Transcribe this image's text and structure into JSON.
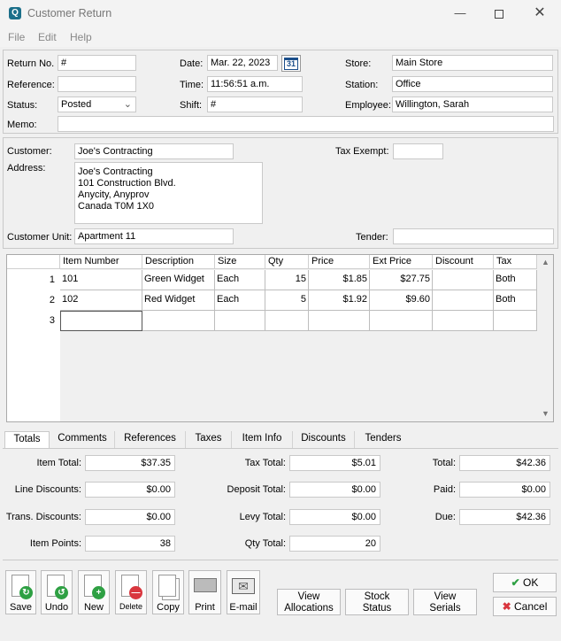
{
  "window": {
    "title": "Customer Return",
    "app_icon": "Q"
  },
  "menu": [
    "File",
    "Edit",
    "Help"
  ],
  "header": {
    "return_no_label": "Return No.",
    "return_no": "#",
    "reference_label": "Reference:",
    "reference": "",
    "status_label": "Status:",
    "status": "Posted",
    "memo_label": "Memo:",
    "memo": "",
    "date_label": "Date:",
    "date": "Mar. 22, 2023",
    "calendar_day": "31",
    "time_label": "Time:",
    "time": "11:56:51 a.m.",
    "shift_label": "Shift:",
    "shift": "#",
    "store_label": "Store:",
    "store": "Main Store",
    "station_label": "Station:",
    "station": "Office",
    "employee_label": "Employee:",
    "employee": "Willington, Sarah"
  },
  "customer": {
    "customer_label": "Customer:",
    "customer": "Joe's Contracting",
    "address_label": "Address:",
    "address_lines": [
      "Joe's Contracting",
      "101 Construction Blvd.",
      "Anycity, Anyprov",
      "Canada  T0M 1X0"
    ],
    "tax_exempt_label": "Tax Exempt:",
    "tax_exempt": "",
    "unit_label": "Customer Unit:",
    "unit": "Apartment 11",
    "tender_label": "Tender:",
    "tender": ""
  },
  "grid": {
    "columns": [
      "Item Number",
      "Description",
      "Size",
      "Qty",
      "Price",
      "Ext Price",
      "Discount",
      "Tax"
    ],
    "rows": [
      {
        "n": "1",
        "item": "101",
        "desc": "Green Widget",
        "size": "Each",
        "qty": "15",
        "price": "$1.85",
        "ext": "$27.75",
        "disc": "",
        "tax": "Both"
      },
      {
        "n": "2",
        "item": "102",
        "desc": "Red Widget",
        "size": "Each",
        "qty": "5",
        "price": "$1.92",
        "ext": "$9.60",
        "disc": "",
        "tax": "Both"
      },
      {
        "n": "3",
        "item": "",
        "desc": "",
        "size": "",
        "qty": "",
        "price": "",
        "ext": "",
        "disc": "",
        "tax": ""
      }
    ]
  },
  "tabs": [
    "Totals",
    "Comments",
    "References",
    "Taxes",
    "Item Info",
    "Discounts",
    "Tenders"
  ],
  "totals": {
    "item_total_label": "Item Total:",
    "item_total": "$37.35",
    "line_disc_label": "Line Discounts:",
    "line_disc": "$0.00",
    "trans_disc_label": "Trans. Discounts:",
    "trans_disc": "$0.00",
    "item_points_label": "Item Points:",
    "item_points": "38",
    "tax_total_label": "Tax Total:",
    "tax_total": "$5.01",
    "deposit_label": "Deposit Total:",
    "deposit": "$0.00",
    "levy_label": "Levy Total:",
    "levy": "$0.00",
    "qty_label": "Qty Total:",
    "qty": "20",
    "total_label": "Total:",
    "total": "$42.36",
    "paid_label": "Paid:",
    "paid": "$0.00",
    "due_label": "Due:",
    "due": "$42.36"
  },
  "toolbar": {
    "save": "Save",
    "undo": "Undo",
    "new": "New",
    "delete": "Delete",
    "copy": "Copy",
    "print": "Print",
    "email": "E-mail"
  },
  "buttons": {
    "view_alloc_1": "View",
    "view_alloc_2": "Allocations",
    "stock_1": "Stock",
    "stock_2": "Status",
    "serials_1": "View",
    "serials_2": "Serials",
    "ok": "OK",
    "cancel": "Cancel"
  },
  "colors": {
    "accent_green": "#2ea043",
    "accent_red": "#d9363e",
    "window_bg": "#f0f0f0"
  }
}
